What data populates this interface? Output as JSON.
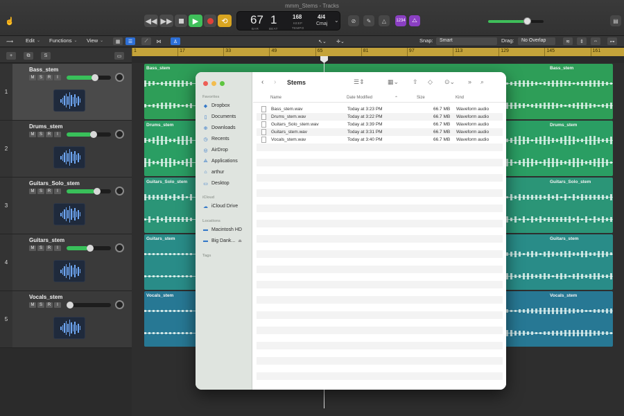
{
  "window": {
    "title": "mmm_Stems - Tracks"
  },
  "transport": {
    "bar": "67",
    "beat": "1",
    "bar_label": "BAR",
    "beat_label": "BEAT",
    "tempo": "168",
    "tempo_mode": "KEEP",
    "tempo_label": "TEMPO",
    "signature": "4/4",
    "key": "Cmaj",
    "count_in": "1234",
    "master_volume_fraction": 0.7
  },
  "toolbar": {
    "edit": "Edit",
    "functions": "Functions",
    "view": "View",
    "snap_label": "Snap:",
    "snap_value": "Smart",
    "drag_label": "Drag:",
    "drag_value": "No Overlap"
  },
  "ruler": {
    "bars": [
      "1",
      "17",
      "33",
      "49",
      "65",
      "81",
      "97",
      "113",
      "129",
      "145",
      "161"
    ]
  },
  "tracks": [
    {
      "number": "1",
      "name": "Bass_stem",
      "region": "Bass_stem",
      "volume_fraction": 0.66,
      "color": "#2e9e58",
      "selected": true
    },
    {
      "number": "2",
      "name": "Drums_stem",
      "region": "Drums_stem",
      "volume_fraction": 0.62,
      "color": "#2a9e63",
      "selected": false
    },
    {
      "number": "3",
      "name": "Guitars_Solo_stem",
      "region": "Guitars_Solo_stem",
      "volume_fraction": 0.7,
      "color": "#2b9577",
      "selected": false
    },
    {
      "number": "4",
      "name": "Guitars_stem",
      "region": "Guitars_stem",
      "volume_fraction": 0.55,
      "color": "#298c88",
      "selected": false
    },
    {
      "number": "5",
      "name": "Vocals_stem",
      "region": "Vocals_stem",
      "volume_fraction": 0.0,
      "color": "#277894",
      "selected": false
    }
  ],
  "track_buttons": {
    "mute": "M",
    "solo": "S",
    "record": "R",
    "input": "I"
  },
  "finder": {
    "title": "Stems",
    "sections": {
      "favorites": "Favorites",
      "icloud": "iCloud",
      "locations": "Locations",
      "tags": "Tags"
    },
    "favorites": [
      "Dropbox",
      "Documents",
      "Downloads",
      "Recents",
      "AirDrop",
      "Applications",
      "arthur",
      "Desktop"
    ],
    "icloud": [
      "iCloud Drive"
    ],
    "locations": [
      "Macintosh HD",
      "Big Dank..."
    ],
    "columns": {
      "name": "Name",
      "date": "Date Modified",
      "size": "Size",
      "kind": "Kind"
    },
    "files": [
      {
        "name": "Bass_stem.wav",
        "date": "Today at 3:23 PM",
        "size": "66.7 MB",
        "kind": "Waveform audio"
      },
      {
        "name": "Drums_stem.wav",
        "date": "Today at 3:22 PM",
        "size": "66.7 MB",
        "kind": "Waveform audio"
      },
      {
        "name": "Guitars_Solo_stem.wav",
        "date": "Today at 3:39 PM",
        "size": "66.7 MB",
        "kind": "Waveform audio"
      },
      {
        "name": "Guitars_stem.wav",
        "date": "Today at 3:31 PM",
        "size": "66.7 MB",
        "kind": "Waveform audio"
      },
      {
        "name": "Vocals_stem.wav",
        "date": "Today at 3:40 PM",
        "size": "66.7 MB",
        "kind": "Waveform audio"
      }
    ]
  },
  "colors": {
    "ruler": "#c4a33a",
    "accent": "#2d6fd6",
    "play": "#3fbf5a",
    "record": "#e0413a",
    "cycle": "#d9a520"
  }
}
